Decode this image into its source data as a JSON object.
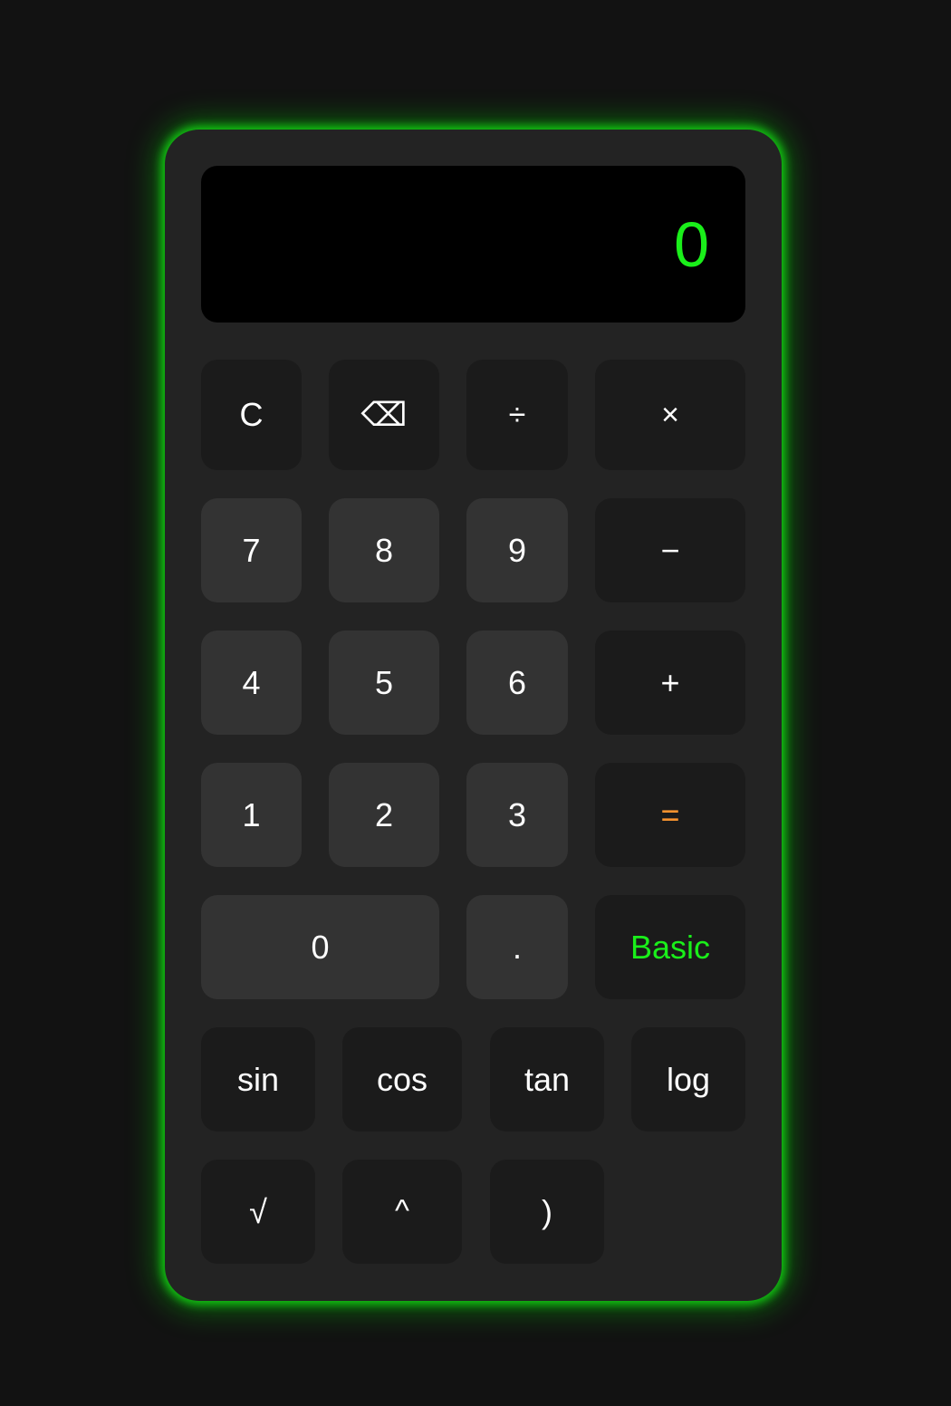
{
  "display": {
    "value": "0"
  },
  "colors": {
    "background": "#121212",
    "calculator": "#232323",
    "accent_green": "#1aef1a",
    "equals_orange": "#f5922f",
    "number_key": "#333333",
    "operator_key": "#1b1b1b"
  },
  "keys": {
    "clear": "C",
    "backspace": "⌫",
    "divide": "÷",
    "multiply": "×",
    "seven": "7",
    "eight": "8",
    "nine": "9",
    "minus": "−",
    "four": "4",
    "five": "5",
    "six": "6",
    "plus": "+",
    "one": "1",
    "two": "2",
    "three": "3",
    "equals": "=",
    "zero": "0",
    "decimal": ".",
    "mode": "Basic",
    "sin": "sin",
    "cos": "cos",
    "tan": "tan",
    "log": "log",
    "sqrt": "√",
    "power": "^",
    "close_paren": ")"
  }
}
